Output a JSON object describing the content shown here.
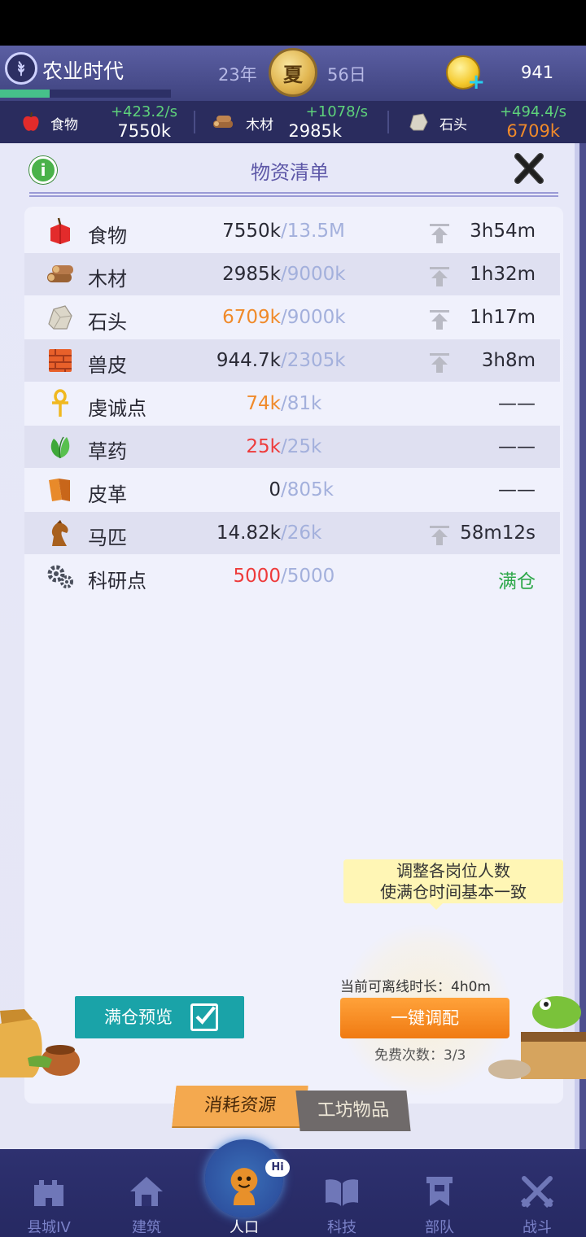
{
  "hud": {
    "era_title": "农业时代",
    "era_progress": 0.29,
    "year": "23年",
    "season": "夏",
    "day": "56日",
    "coins": "941"
  },
  "resource_bar": [
    {
      "icon": "apple-icon",
      "name": "食物",
      "rate": "+423.2/s",
      "amount": "7550k"
    },
    {
      "icon": "wood-icon",
      "name": "木材",
      "rate": "+1078/s",
      "amount": "2985k"
    },
    {
      "icon": "stone-icon",
      "name": "石头",
      "rate": "+494.4/s",
      "amount": "6709k"
    }
  ],
  "panel": {
    "title": "物资清单",
    "info": "i"
  },
  "rows": [
    {
      "icon": "apple-icon",
      "label": "食物",
      "current": "7550k",
      "capacity": "/13.5M",
      "time": "3h54m"
    },
    {
      "icon": "wood-icon",
      "label": "木材",
      "current": "2985k",
      "capacity": "/9000k",
      "time": "1h32m"
    },
    {
      "icon": "stone-icon",
      "label": "石头",
      "current": "6709k",
      "capacity": "/9000k",
      "time": "1h17m"
    },
    {
      "icon": "hide-icon",
      "label": "兽皮",
      "current": "944.7k",
      "capacity": "/2305k",
      "time": "3h8m"
    },
    {
      "icon": "ankh-icon",
      "label": "虔诚点",
      "current": "74k",
      "capacity": "/81k",
      "time": "——"
    },
    {
      "icon": "herb-icon",
      "label": "草药",
      "current": "25k",
      "capacity": "/25k",
      "time": "——"
    },
    {
      "icon": "leather-icon",
      "label": "皮革",
      "current": "0",
      "capacity": "/805k",
      "time": "——"
    },
    {
      "icon": "horse-icon",
      "label": "马匹",
      "current": "14.82k",
      "capacity": "/26k",
      "time": "58m12s"
    },
    {
      "icon": "gears-icon",
      "label": "科研点",
      "current": "5000",
      "capacity": "/5000",
      "time": "满仓"
    }
  ],
  "tooltip": {
    "line1": "调整各岗位人数",
    "line2": "使满仓时间基本一致"
  },
  "offline": "当前可离线时长：4h0m",
  "adjust_button": "一键调配",
  "free_count": "免费次数：3/3",
  "preview_button": "满仓预览",
  "tabs": {
    "active": "消耗资源",
    "inactive": "工坊物品"
  },
  "nav": [
    {
      "icon": "castle-icon",
      "label": "县城IV"
    },
    {
      "icon": "house-icon",
      "label": "建筑"
    },
    {
      "icon": "population-icon",
      "label": "人口",
      "badge": "Hi"
    },
    {
      "icon": "book-icon",
      "label": "科技"
    },
    {
      "icon": "banner-icon",
      "label": "部队"
    },
    {
      "icon": "swords-icon",
      "label": "战斗"
    }
  ],
  "colors": {
    "accent_orange": "#f08a2a",
    "warn_red": "#ee3b3b",
    "full_green": "#2ea84a",
    "capacity_blue": "#a3b0dc"
  }
}
